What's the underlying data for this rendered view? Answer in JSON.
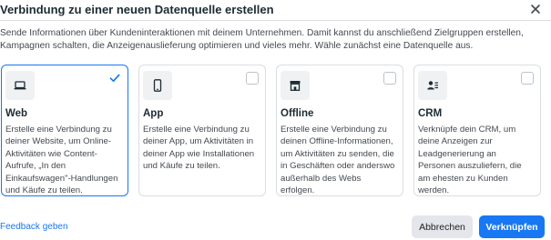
{
  "dialog": {
    "title": "Verbindung zu einer neuen Datenquelle erstellen",
    "description": "Sende Informationen über Kundeninteraktionen mit deinem Unternehmen. Damit kannst du anschließend Zielgruppen erstellen, Kampagnen schalten, die Anzeigenauslieferung optimieren und vieles mehr. Wähle zunächst eine Datenquelle aus."
  },
  "cards": [
    {
      "title": "Web",
      "icon": "laptop-icon",
      "selected": true,
      "description": "Erstelle eine Verbindung zu deiner Website, um Online-Aktivitäten wie Content-Aufrufe, „In den Einkaufswagen\"-Handlungen und Käufe zu teilen."
    },
    {
      "title": "App",
      "icon": "mobile-icon",
      "selected": false,
      "description": "Erstelle eine Verbindung zu deiner App, um Aktivitäten in deiner App wie Installationen und Käufe zu teilen."
    },
    {
      "title": "Offline",
      "icon": "store-icon",
      "selected": false,
      "description": "Erstelle eine Verbindung zu deinen Offline-Informationen, um Aktivitäten zu senden, die in Geschäften oder anderswo außerhalb des Webs erfolgen."
    },
    {
      "title": "CRM",
      "icon": "contacts-icon",
      "selected": false,
      "description": "Verknüpfe dein CRM, um deine Anzeigen zur Leadgenerierung an Personen auszuliefern, die am ehesten zu Kunden werden."
    }
  ],
  "footer": {
    "feedback_link": "Feedback geben",
    "cancel_label": "Abbrechen",
    "connect_label": "Verknüpfen"
  },
  "colors": {
    "accent": "#1877f2",
    "border": "#dadde1",
    "icon_bg": "#eff1f3"
  }
}
